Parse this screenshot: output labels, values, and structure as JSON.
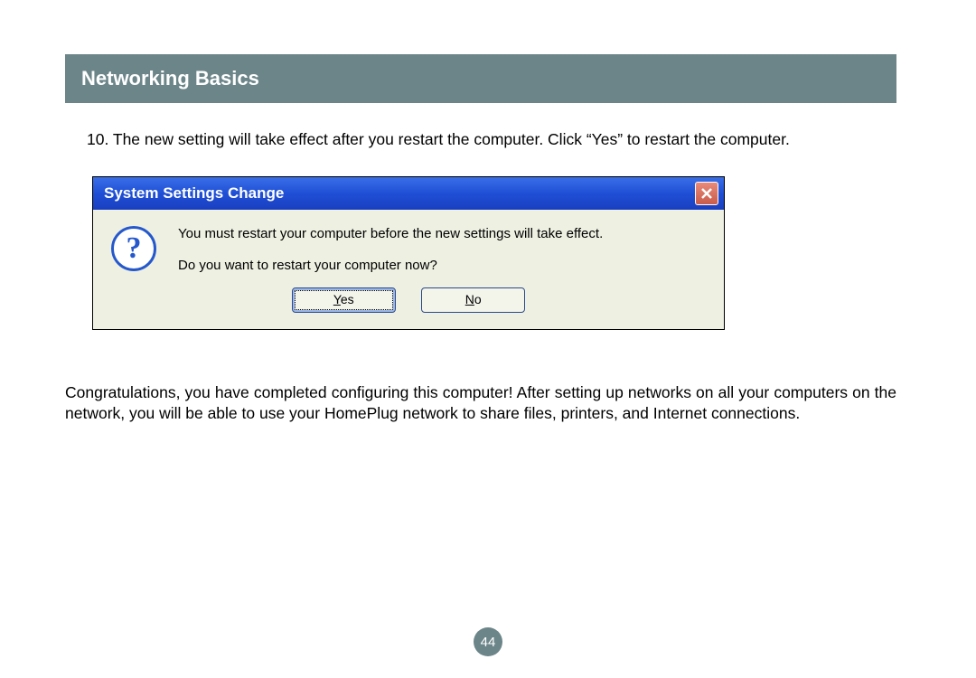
{
  "header": {
    "title": "Networking Basics"
  },
  "step": {
    "text": "10. The new setting will take effect after you restart the computer. Click “Yes” to restart the computer."
  },
  "dialog": {
    "title": "System Settings Change",
    "message1": "You must restart your computer before the new settings will take effect.",
    "message2": "Do you want to restart your computer now?",
    "yes_underline": "Y",
    "yes_rest": "es",
    "no_underline": "N",
    "no_rest": "o",
    "question_mark": "?"
  },
  "congrats": {
    "text": "Congratulations, you have completed configuring this computer! After setting up networks on all your computers on the network, you will be able to use your HomePlug network to share files, printers, and Internet connections."
  },
  "page_number": "44"
}
